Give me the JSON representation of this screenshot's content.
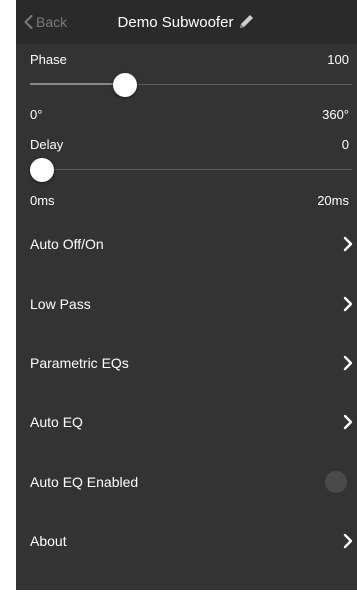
{
  "colors": {
    "background": "#333333",
    "navbar": "#2a2a2a",
    "text": "#ffffff",
    "muted": "#7a7a7a",
    "toggle_off": "#4a4a4a"
  },
  "navbar": {
    "back_label": "Back",
    "title": "Demo Subwoofer",
    "back_icon": "chevron-left-icon",
    "edit_icon": "pencil-icon"
  },
  "phase": {
    "label": "Phase",
    "value": "100",
    "min_label": "0°",
    "max_label": "360°",
    "fraction": 0.28
  },
  "delay": {
    "label": "Delay",
    "value": "0",
    "min_label": "0ms",
    "max_label": "20ms",
    "fraction": 0.0
  },
  "menu": {
    "items": [
      {
        "label": "Auto Off/On",
        "kind": "chevron"
      },
      {
        "label": "Low Pass",
        "kind": "chevron"
      },
      {
        "label": "Parametric EQs",
        "kind": "chevron"
      },
      {
        "label": "Auto EQ",
        "kind": "chevron"
      },
      {
        "label": "Auto EQ Enabled",
        "kind": "toggle",
        "enabled": false
      },
      {
        "label": "About",
        "kind": "chevron"
      }
    ]
  }
}
